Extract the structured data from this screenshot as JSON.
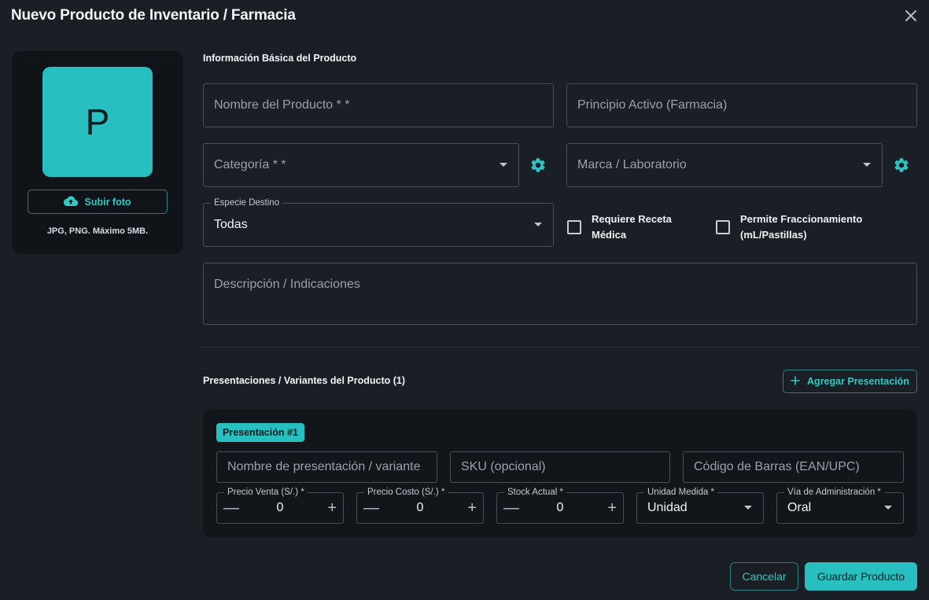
{
  "dialog": {
    "title": "Nuevo Producto de Inventario / Farmacia"
  },
  "photo": {
    "avatar_letter": "P",
    "upload_label": "Subir foto",
    "hint": "JPG, PNG. Máximo 5MB."
  },
  "basic_info": {
    "section_title": "Información Básica del Producto",
    "product_name_placeholder": "Nombre del Producto * *",
    "active_ingredient_placeholder": "Principio Activo (Farmacia)",
    "category_placeholder": "Categoría * *",
    "brand_placeholder": "Marca / Laboratorio",
    "species_label": "Especie Destino",
    "species_value": "Todas",
    "requires_prescription_label": "Requiere Receta Médica",
    "allows_fractioning_label": "Permite Fraccionamiento (mL/Pastillas)",
    "description_placeholder": "Descripción / Indicaciones"
  },
  "variants": {
    "section_title": "Presentaciones / Variantes del Producto (1)",
    "add_label": "Agregar Presentación",
    "items": [
      {
        "chip": "Presentación #1",
        "name_placeholder": "Nombre de presentación / variante",
        "sku_placeholder": "SKU (opcional)",
        "barcode_placeholder": "Código de Barras (EAN/UPC)",
        "sale_price_label": "Precio Venta (S/.) *",
        "sale_price_value": "0",
        "cost_price_label": "Precio Costo (S/.) *",
        "cost_price_value": "0",
        "stock_label": "Stock Actual *",
        "stock_value": "0",
        "unit_label": "Unidad Medida *",
        "unit_value": "Unidad",
        "route_label": "Vía de Administración *",
        "route_value": "Oral"
      }
    ]
  },
  "footer": {
    "cancel_label": "Cancelar",
    "save_label": "Guardar Producto"
  },
  "colors": {
    "accent": "#27bfbf",
    "background": "#1a1e25",
    "card": "#101419"
  },
  "icons": {
    "close": "close-icon",
    "upload": "cloud-upload-icon",
    "settings": "gear-icon",
    "add": "plus-icon"
  }
}
